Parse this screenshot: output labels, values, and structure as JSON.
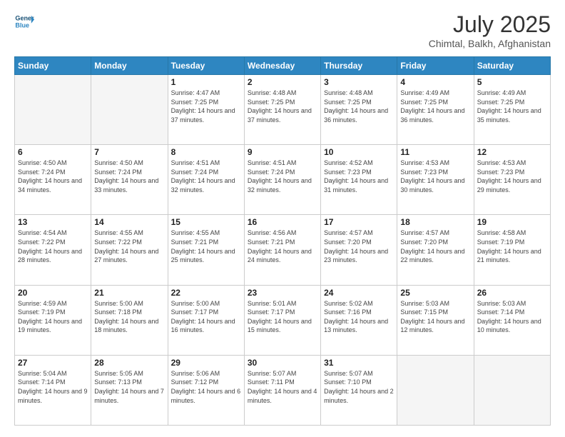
{
  "header": {
    "logo_line1": "General",
    "logo_line2": "Blue",
    "title": "July 2025",
    "subtitle": "Chimtal, Balkh, Afghanistan"
  },
  "weekdays": [
    "Sunday",
    "Monday",
    "Tuesday",
    "Wednesday",
    "Thursday",
    "Friday",
    "Saturday"
  ],
  "weeks": [
    [
      {
        "day": "",
        "empty": true
      },
      {
        "day": "",
        "empty": true
      },
      {
        "day": "1",
        "sunrise": "4:47 AM",
        "sunset": "7:25 PM",
        "daylight": "14 hours and 37 minutes."
      },
      {
        "day": "2",
        "sunrise": "4:48 AM",
        "sunset": "7:25 PM",
        "daylight": "14 hours and 37 minutes."
      },
      {
        "day": "3",
        "sunrise": "4:48 AM",
        "sunset": "7:25 PM",
        "daylight": "14 hours and 36 minutes."
      },
      {
        "day": "4",
        "sunrise": "4:49 AM",
        "sunset": "7:25 PM",
        "daylight": "14 hours and 36 minutes."
      },
      {
        "day": "5",
        "sunrise": "4:49 AM",
        "sunset": "7:25 PM",
        "daylight": "14 hours and 35 minutes."
      }
    ],
    [
      {
        "day": "6",
        "sunrise": "4:50 AM",
        "sunset": "7:24 PM",
        "daylight": "14 hours and 34 minutes."
      },
      {
        "day": "7",
        "sunrise": "4:50 AM",
        "sunset": "7:24 PM",
        "daylight": "14 hours and 33 minutes."
      },
      {
        "day": "8",
        "sunrise": "4:51 AM",
        "sunset": "7:24 PM",
        "daylight": "14 hours and 32 minutes."
      },
      {
        "day": "9",
        "sunrise": "4:51 AM",
        "sunset": "7:24 PM",
        "daylight": "14 hours and 32 minutes."
      },
      {
        "day": "10",
        "sunrise": "4:52 AM",
        "sunset": "7:23 PM",
        "daylight": "14 hours and 31 minutes."
      },
      {
        "day": "11",
        "sunrise": "4:53 AM",
        "sunset": "7:23 PM",
        "daylight": "14 hours and 30 minutes."
      },
      {
        "day": "12",
        "sunrise": "4:53 AM",
        "sunset": "7:23 PM",
        "daylight": "14 hours and 29 minutes."
      }
    ],
    [
      {
        "day": "13",
        "sunrise": "4:54 AM",
        "sunset": "7:22 PM",
        "daylight": "14 hours and 28 minutes."
      },
      {
        "day": "14",
        "sunrise": "4:55 AM",
        "sunset": "7:22 PM",
        "daylight": "14 hours and 27 minutes."
      },
      {
        "day": "15",
        "sunrise": "4:55 AM",
        "sunset": "7:21 PM",
        "daylight": "14 hours and 25 minutes."
      },
      {
        "day": "16",
        "sunrise": "4:56 AM",
        "sunset": "7:21 PM",
        "daylight": "14 hours and 24 minutes."
      },
      {
        "day": "17",
        "sunrise": "4:57 AM",
        "sunset": "7:20 PM",
        "daylight": "14 hours and 23 minutes."
      },
      {
        "day": "18",
        "sunrise": "4:57 AM",
        "sunset": "7:20 PM",
        "daylight": "14 hours and 22 minutes."
      },
      {
        "day": "19",
        "sunrise": "4:58 AM",
        "sunset": "7:19 PM",
        "daylight": "14 hours and 21 minutes."
      }
    ],
    [
      {
        "day": "20",
        "sunrise": "4:59 AM",
        "sunset": "7:19 PM",
        "daylight": "14 hours and 19 minutes."
      },
      {
        "day": "21",
        "sunrise": "5:00 AM",
        "sunset": "7:18 PM",
        "daylight": "14 hours and 18 minutes."
      },
      {
        "day": "22",
        "sunrise": "5:00 AM",
        "sunset": "7:17 PM",
        "daylight": "14 hours and 16 minutes."
      },
      {
        "day": "23",
        "sunrise": "5:01 AM",
        "sunset": "7:17 PM",
        "daylight": "14 hours and 15 minutes."
      },
      {
        "day": "24",
        "sunrise": "5:02 AM",
        "sunset": "7:16 PM",
        "daylight": "14 hours and 13 minutes."
      },
      {
        "day": "25",
        "sunrise": "5:03 AM",
        "sunset": "7:15 PM",
        "daylight": "14 hours and 12 minutes."
      },
      {
        "day": "26",
        "sunrise": "5:03 AM",
        "sunset": "7:14 PM",
        "daylight": "14 hours and 10 minutes."
      }
    ],
    [
      {
        "day": "27",
        "sunrise": "5:04 AM",
        "sunset": "7:14 PM",
        "daylight": "14 hours and 9 minutes."
      },
      {
        "day": "28",
        "sunrise": "5:05 AM",
        "sunset": "7:13 PM",
        "daylight": "14 hours and 7 minutes."
      },
      {
        "day": "29",
        "sunrise": "5:06 AM",
        "sunset": "7:12 PM",
        "daylight": "14 hours and 6 minutes."
      },
      {
        "day": "30",
        "sunrise": "5:07 AM",
        "sunset": "7:11 PM",
        "daylight": "14 hours and 4 minutes."
      },
      {
        "day": "31",
        "sunrise": "5:07 AM",
        "sunset": "7:10 PM",
        "daylight": "14 hours and 2 minutes."
      },
      {
        "day": "",
        "empty": true
      },
      {
        "day": "",
        "empty": true
      }
    ]
  ],
  "labels": {
    "sunrise_prefix": "Sunrise: ",
    "sunset_prefix": "Sunset: ",
    "daylight_prefix": "Daylight: "
  }
}
